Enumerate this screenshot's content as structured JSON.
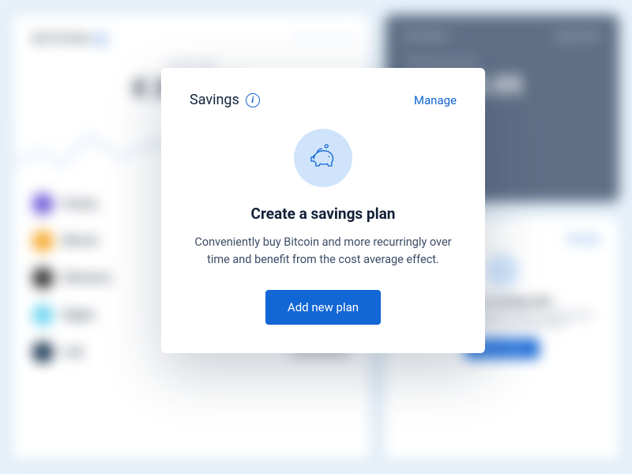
{
  "bg": {
    "portfolio": {
      "title": "My Portfolio",
      "current_label": "Current value",
      "current_value": "€ 2950.06",
      "assets": [
        {
          "name": "Pantos",
          "amount": ""
        },
        {
          "name": "Bitcoin",
          "amount": ""
        },
        {
          "name": "Ethereum",
          "amount": ""
        },
        {
          "name": "Ripple",
          "amount": ""
        },
        {
          "name": "Lisk",
          "amount": "1.00 58.0010"
        }
      ]
    },
    "fees": {
      "left": "Fee history",
      "right": "Export files",
      "sub": "Total funds in Euro",
      "value": "€ 3284.05"
    },
    "promo": {
      "link": "Manage",
      "title": "Create a savings plan",
      "desc": "Conveniently buy Bitcoin and more recurringly and benefit from the cost average effect.",
      "btn": "Add new plan"
    }
  },
  "modal": {
    "title": "Savings",
    "manage": "Manage",
    "headline": "Create a savings plan",
    "body": "Conveniently buy Bitcoin and more recurringly over time and benefit from the cost average effect.",
    "cta": "Add new plan"
  }
}
